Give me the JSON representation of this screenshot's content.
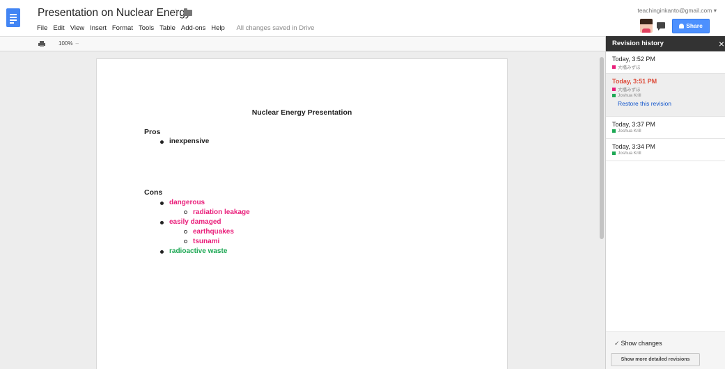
{
  "document": {
    "title": "Presentation on Nuclear Energy",
    "save_status": "All changes saved in Drive"
  },
  "menu": [
    "File",
    "Edit",
    "View",
    "Insert",
    "Format",
    "Tools",
    "Table",
    "Add-ons",
    "Help"
  ],
  "account": {
    "email": "teachinginkanto@gmail.com ▾"
  },
  "share_label": "Share",
  "toolbar": {
    "zoom": "100%",
    "zoom_arrow": "–"
  },
  "content": {
    "heading": "Nuclear Energy Presentation",
    "pros_label": "Pros",
    "pros": [
      "inexpensive"
    ],
    "cons_label": "Cons",
    "cons": [
      "dangerous",
      "radiation leakage",
      "easily damaged",
      "earthquakes",
      "tsunami",
      "radioactive waste"
    ]
  },
  "history": {
    "title": "Revision history",
    "close": "×",
    "revisions": [
      {
        "time": "Today, 3:52 PM",
        "authors": [
          "大橋みずほ"
        ]
      },
      {
        "time": "Today, 3:51 PM",
        "authors": [
          "大橋みずほ",
          "Joshua Krill"
        ],
        "restore": "Restore this revision"
      },
      {
        "time": "Today, 3:37 PM",
        "authors": [
          "Joshua Krill"
        ]
      },
      {
        "time": "Today, 3:34 PM",
        "authors": [
          "Joshua Krill"
        ]
      }
    ],
    "show_changes": "Show changes",
    "detailed_button": "Show more detailed revisions"
  },
  "colors": {
    "accent": "#4285f4",
    "share": "#4d90fe",
    "author_1": "#e91e7a",
    "author_2": "#1da854",
    "selected_time": "#dd4b39"
  },
  "icons": [
    "docs-logo-icon",
    "star-icon",
    "folder-icon",
    "print-icon",
    "comments-icon",
    "share-person-icon",
    "close-icon",
    "checkmark-icon"
  ]
}
